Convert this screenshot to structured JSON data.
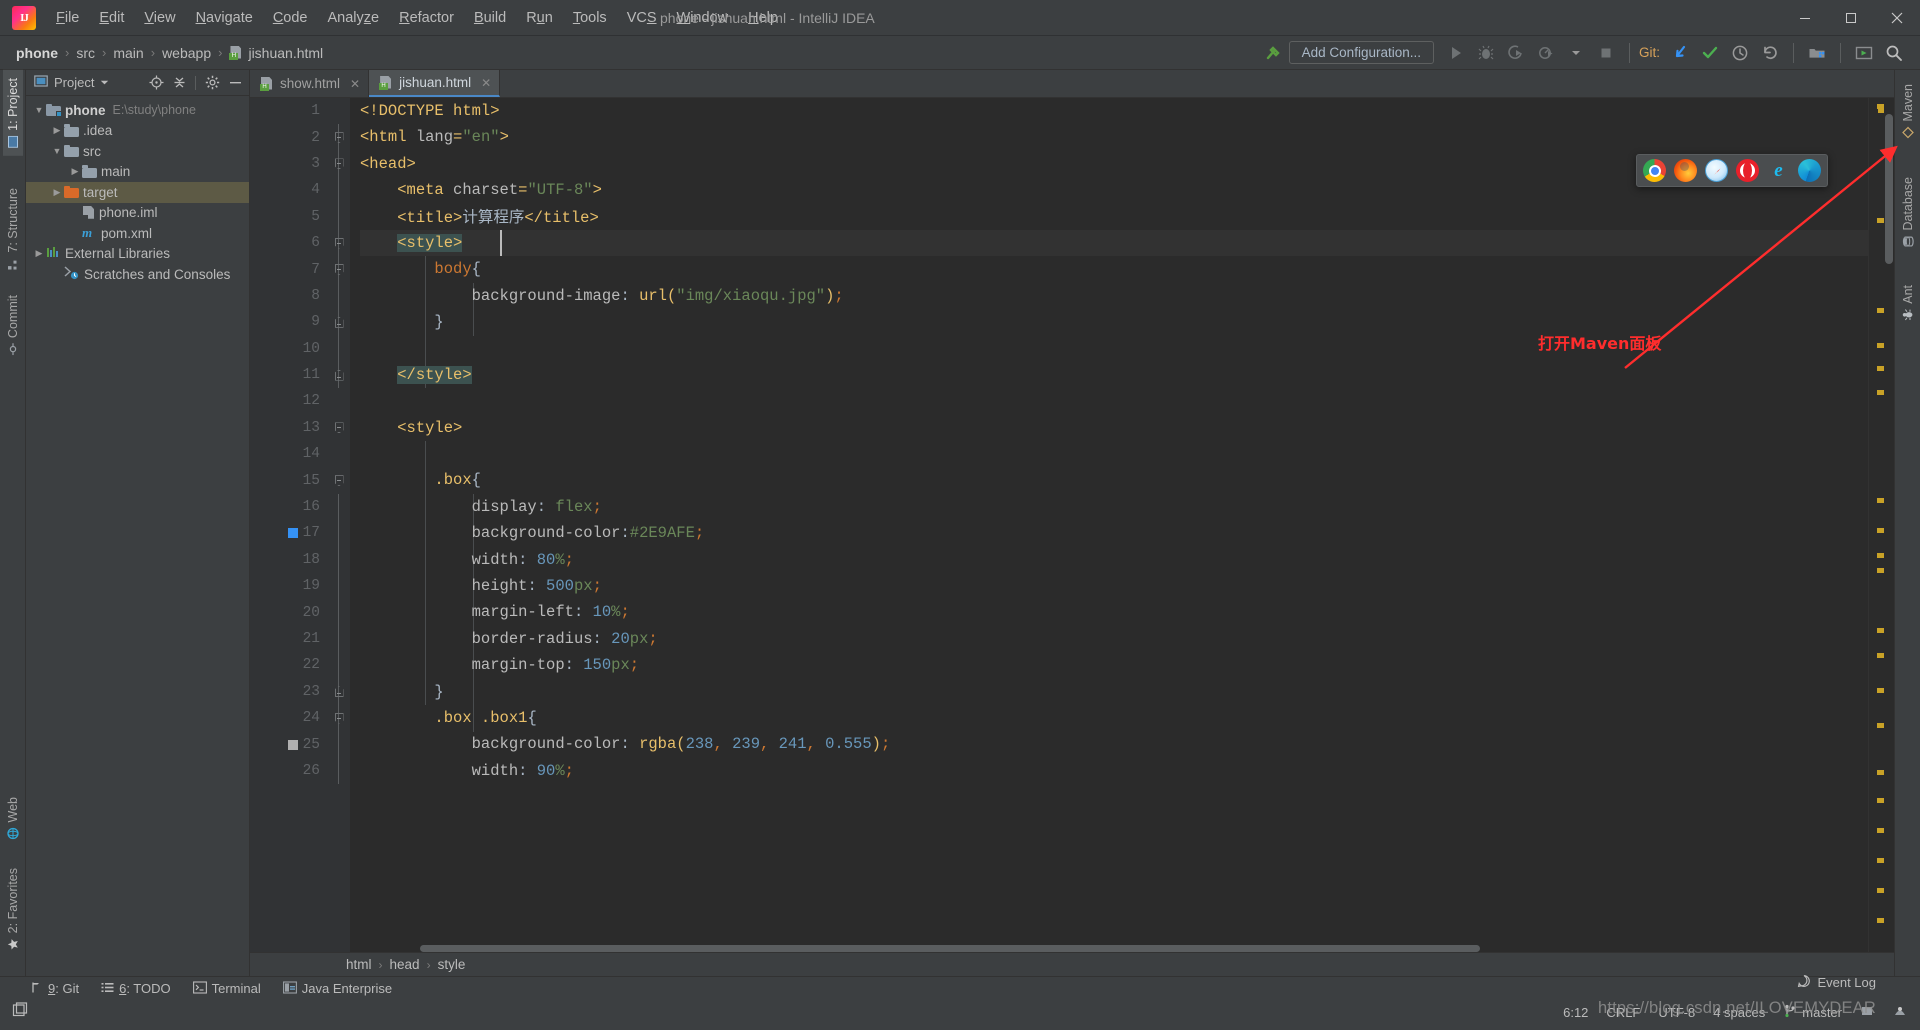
{
  "window": {
    "title": "phone - jishuan.html - IntelliJ IDEA",
    "minimize": "—",
    "maximize": "❐",
    "close": "✕"
  },
  "menubar": {
    "items": [
      {
        "label": "File",
        "mnemonic": "F"
      },
      {
        "label": "Edit",
        "mnemonic": "E"
      },
      {
        "label": "View",
        "mnemonic": "V"
      },
      {
        "label": "Navigate",
        "mnemonic": "N"
      },
      {
        "label": "Code",
        "mnemonic": "C"
      },
      {
        "label": "Analyze",
        "mnemonic": "z"
      },
      {
        "label": "Refactor",
        "mnemonic": "R"
      },
      {
        "label": "Build",
        "mnemonic": "B"
      },
      {
        "label": "Run",
        "mnemonic": "u"
      },
      {
        "label": "Tools",
        "mnemonic": "T"
      },
      {
        "label": "VCS",
        "mnemonic": "S"
      },
      {
        "label": "Window",
        "mnemonic": "W"
      },
      {
        "label": "Help",
        "mnemonic": "H"
      }
    ]
  },
  "navbar": {
    "crumbs": [
      "phone",
      "src",
      "main",
      "webapp",
      "jishuan.html"
    ],
    "separator": "›",
    "run_configuration": "Add Configuration...",
    "git_label": "Git:"
  },
  "left_strip": {
    "top_tabs": [
      "1: Project",
      "7: Structure",
      "Commit"
    ],
    "bottom_tabs": [
      "2: Favorites",
      "Web"
    ]
  },
  "right_strip": {
    "tabs": [
      "Maven",
      "Database",
      "Ant"
    ]
  },
  "project_panel": {
    "title": "Project",
    "tree": [
      {
        "label": "phone",
        "path": "E:\\study\\phone",
        "depth": 0,
        "arrow": "open",
        "icon": "module-folder",
        "bold": true,
        "selected": false
      },
      {
        "label": ".idea",
        "path": "",
        "depth": 1,
        "arrow": "closed",
        "icon": "folder",
        "bold": false,
        "selected": false
      },
      {
        "label": "src",
        "path": "",
        "depth": 1,
        "arrow": "open",
        "icon": "folder",
        "bold": false,
        "selected": false
      },
      {
        "label": "main",
        "path": "",
        "depth": 2,
        "arrow": "closed",
        "icon": "folder",
        "bold": false,
        "selected": false
      },
      {
        "label": "target",
        "path": "",
        "depth": 1,
        "arrow": "closed",
        "icon": "folder-orange",
        "bold": false,
        "selected": true
      },
      {
        "label": "phone.iml",
        "path": "",
        "depth": 2,
        "arrow": "none",
        "icon": "iml-file",
        "bold": false,
        "selected": false
      },
      {
        "label": "pom.xml",
        "path": "",
        "depth": 2,
        "arrow": "none",
        "icon": "maven-file",
        "bold": false,
        "selected": false
      },
      {
        "label": "External Libraries",
        "path": "",
        "depth": 0,
        "arrow": "closed",
        "icon": "libraries",
        "bold": false,
        "selected": false
      },
      {
        "label": "Scratches and Consoles",
        "path": "",
        "depth": 0,
        "arrow": "none",
        "icon": "scratches",
        "bold": false,
        "selected": false
      }
    ]
  },
  "editor": {
    "tabs": [
      {
        "label": "show.html",
        "active": false
      },
      {
        "label": "jishuan.html",
        "active": true
      }
    ],
    "close_glyph": "✕",
    "lines": [
      {
        "n": 1,
        "fold": "none",
        "indent": 0,
        "current": false
      },
      {
        "n": 2,
        "fold": "down",
        "indent": 0,
        "current": false
      },
      {
        "n": 3,
        "fold": "down",
        "indent": 0,
        "current": false
      },
      {
        "n": 4,
        "fold": "none",
        "indent": 1,
        "current": false
      },
      {
        "n": 5,
        "fold": "none",
        "indent": 1,
        "current": false
      },
      {
        "n": 6,
        "fold": "down",
        "indent": 1,
        "current": true
      },
      {
        "n": 7,
        "fold": "down",
        "indent": 2,
        "current": false
      },
      {
        "n": 8,
        "fold": "none",
        "indent": 3,
        "current": false
      },
      {
        "n": 9,
        "fold": "up",
        "indent": 2,
        "current": false
      },
      {
        "n": 10,
        "fold": "none",
        "indent": 0,
        "current": false
      },
      {
        "n": 11,
        "fold": "up",
        "indent": 1,
        "current": false
      },
      {
        "n": 12,
        "fold": "none",
        "indent": 0,
        "current": false
      },
      {
        "n": 13,
        "fold": "down",
        "indent": 1,
        "current": false
      },
      {
        "n": 14,
        "fold": "none",
        "indent": 0,
        "current": false
      },
      {
        "n": 15,
        "fold": "down",
        "indent": 2,
        "current": false
      },
      {
        "n": 16,
        "fold": "none",
        "indent": 3,
        "current": false
      },
      {
        "n": 17,
        "fold": "none",
        "indent": 3,
        "current": false,
        "marker": "#3592f5"
      },
      {
        "n": 18,
        "fold": "none",
        "indent": 3,
        "current": false
      },
      {
        "n": 19,
        "fold": "none",
        "indent": 3,
        "current": false
      },
      {
        "n": 20,
        "fold": "none",
        "indent": 3,
        "current": false
      },
      {
        "n": 21,
        "fold": "none",
        "indent": 3,
        "current": false
      },
      {
        "n": 22,
        "fold": "none",
        "indent": 3,
        "current": false
      },
      {
        "n": 23,
        "fold": "up",
        "indent": 2,
        "current": false
      },
      {
        "n": 24,
        "fold": "down",
        "indent": 2,
        "current": false
      },
      {
        "n": 25,
        "fold": "none",
        "indent": 3,
        "current": false,
        "marker": "#b0b0b0"
      },
      {
        "n": 26,
        "fold": "none",
        "indent": 3,
        "current": false
      }
    ],
    "source_text": [
      "<!DOCTYPE html>",
      "<html lang=\"en\">",
      "<head>",
      "    <meta charset=\"UTF-8\">",
      "    <title>计算程序</title>",
      "    <style>",
      "        body{",
      "            background-image: url(\"img/xiaoqu.jpg\");",
      "        }",
      "",
      "    </style>",
      "",
      "    <style>",
      "",
      "        .box{",
      "            display: flex;",
      "            background-color:#2E9AFE;",
      "            width: 80%;",
      "            height: 500px;",
      "            margin-left: 10%;",
      "            border-radius: 20px;",
      "            margin-top: 150px;",
      "        }",
      "        .box .box1{",
      "            background-color: rgba(238, 239, 241, 0.555);",
      "            width: 90%;"
    ],
    "breadcrumbs": [
      "html",
      "head",
      "style"
    ],
    "breadcrumb_sep": "›"
  },
  "browser_popup": {
    "browsers": [
      "chrome-icon",
      "firefox-icon",
      "safari-icon",
      "opera-icon",
      "ie-icon",
      "edge-icon"
    ]
  },
  "annotation": {
    "text": "打开Maven面板",
    "color": "#ff2d2d"
  },
  "toolwindow_bar": {
    "items": [
      {
        "num": "9",
        "label": "Git",
        "icon": "branch-icon"
      },
      {
        "num": "6",
        "label": "TODO",
        "icon": "list-icon"
      },
      {
        "num": "",
        "label": "Terminal",
        "icon": "terminal-icon"
      },
      {
        "num": "",
        "label": "Java Enterprise",
        "icon": "java-ee-icon"
      }
    ]
  },
  "statusbar": {
    "caret_position": "6:12",
    "line_separator": "CRLF",
    "encoding": "UTF-8",
    "indent": "4 spaces",
    "branch": "master",
    "event_log": "Event Log",
    "watermark": "https://blog.csdn.net/ILOVEMYDEAR"
  },
  "colors": {
    "accent_blue": "#3592c4",
    "selection": "#5d5a45",
    "editor_bg": "#2b2b2b",
    "panel_bg": "#3c3f41",
    "annotation_red": "#ff2d2d"
  }
}
